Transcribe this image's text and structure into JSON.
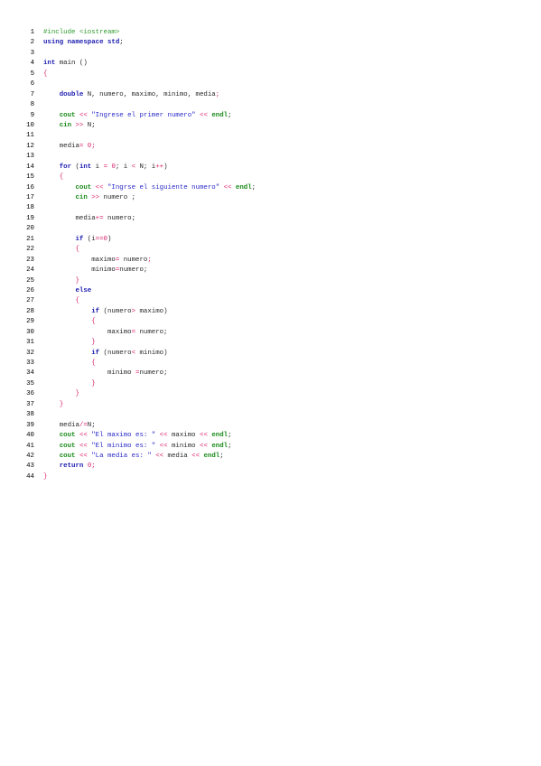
{
  "code": {
    "lines": [
      {
        "n": "1",
        "t": [
          [
            "pp",
            "#include <iostream>"
          ]
        ]
      },
      {
        "n": "2",
        "t": [
          [
            "kw",
            "using namespace std"
          ],
          [
            "pl",
            ";"
          ]
        ]
      },
      {
        "n": "3",
        "t": []
      },
      {
        "n": "4",
        "t": [
          [
            "kw",
            "int"
          ],
          [
            "pl",
            " main ()"
          ]
        ]
      },
      {
        "n": "5",
        "t": [
          [
            "op",
            "{"
          ]
        ]
      },
      {
        "n": "6",
        "t": []
      },
      {
        "n": "7",
        "t": [
          [
            "pl",
            "    "
          ],
          [
            "kw",
            "double"
          ],
          [
            "pl",
            " N, numero, maximo, minimo, media"
          ],
          [
            "op",
            ";"
          ]
        ]
      },
      {
        "n": "8",
        "t": []
      },
      {
        "n": "9",
        "t": [
          [
            "pl",
            "    "
          ],
          [
            "io",
            "cout"
          ],
          [
            "pl",
            " "
          ],
          [
            "op",
            "<<"
          ],
          [
            "pl",
            " "
          ],
          [
            "str",
            "\"Ingrese el primer numero\""
          ],
          [
            "pl",
            " "
          ],
          [
            "op",
            "<<"
          ],
          [
            "pl",
            " "
          ],
          [
            "io",
            "endl"
          ],
          [
            "pl",
            ";"
          ]
        ]
      },
      {
        "n": "10",
        "t": [
          [
            "pl",
            "    "
          ],
          [
            "io",
            "cin"
          ],
          [
            "pl",
            " "
          ],
          [
            "op",
            ">>"
          ],
          [
            "pl",
            " N;"
          ]
        ]
      },
      {
        "n": "11",
        "t": []
      },
      {
        "n": "12",
        "t": [
          [
            "pl",
            "    media"
          ],
          [
            "op",
            "="
          ],
          [
            "pl",
            " "
          ],
          [
            "op",
            "0;"
          ]
        ]
      },
      {
        "n": "13",
        "t": []
      },
      {
        "n": "14",
        "t": [
          [
            "pl",
            "    "
          ],
          [
            "kw",
            "for"
          ],
          [
            "pl",
            " ("
          ],
          [
            "kw",
            "int"
          ],
          [
            "pl",
            " i "
          ],
          [
            "op",
            "="
          ],
          [
            "pl",
            " "
          ],
          [
            "op",
            "0"
          ],
          [
            "pl",
            "; i "
          ],
          [
            "op",
            "<"
          ],
          [
            "pl",
            " N; i"
          ],
          [
            "op",
            "++"
          ],
          [
            "pl",
            ")"
          ]
        ]
      },
      {
        "n": "15",
        "t": [
          [
            "pl",
            "    "
          ],
          [
            "op",
            "{"
          ]
        ]
      },
      {
        "n": "16",
        "t": [
          [
            "pl",
            "        "
          ],
          [
            "io",
            "cout"
          ],
          [
            "pl",
            " "
          ],
          [
            "op",
            "<<"
          ],
          [
            "pl",
            " "
          ],
          [
            "str",
            "\"Ingrse el siguiente numero\""
          ],
          [
            "pl",
            " "
          ],
          [
            "op",
            "<<"
          ],
          [
            "pl",
            " "
          ],
          [
            "io",
            "endl"
          ],
          [
            "pl",
            ";"
          ]
        ]
      },
      {
        "n": "17",
        "t": [
          [
            "pl",
            "        "
          ],
          [
            "io",
            "cin"
          ],
          [
            "pl",
            " "
          ],
          [
            "op",
            ">>"
          ],
          [
            "pl",
            " numero ;"
          ]
        ]
      },
      {
        "n": "18",
        "t": []
      },
      {
        "n": "19",
        "t": [
          [
            "pl",
            "        media"
          ],
          [
            "op",
            "+="
          ],
          [
            "pl",
            " numero;"
          ]
        ]
      },
      {
        "n": "20",
        "t": []
      },
      {
        "n": "21",
        "t": [
          [
            "pl",
            "        "
          ],
          [
            "kw",
            "if"
          ],
          [
            "pl",
            " (i"
          ],
          [
            "op",
            "=="
          ],
          [
            "op",
            "0"
          ],
          [
            "pl",
            ")"
          ]
        ]
      },
      {
        "n": "22",
        "t": [
          [
            "pl",
            "        "
          ],
          [
            "op",
            "{"
          ]
        ]
      },
      {
        "n": "23",
        "t": [
          [
            "pl",
            "            maximo"
          ],
          [
            "op",
            "="
          ],
          [
            "pl",
            " numero"
          ],
          [
            "op",
            ";"
          ]
        ]
      },
      {
        "n": "24",
        "t": [
          [
            "pl",
            "            minimo"
          ],
          [
            "op",
            "="
          ],
          [
            "pl",
            "numero;"
          ]
        ]
      },
      {
        "n": "25",
        "t": [
          [
            "pl",
            "        "
          ],
          [
            "op",
            "}"
          ]
        ]
      },
      {
        "n": "26",
        "t": [
          [
            "pl",
            "        "
          ],
          [
            "kw",
            "else"
          ]
        ]
      },
      {
        "n": "27",
        "t": [
          [
            "pl",
            "        "
          ],
          [
            "op",
            "{"
          ]
        ]
      },
      {
        "n": "28",
        "t": [
          [
            "pl",
            "            "
          ],
          [
            "kw",
            "if"
          ],
          [
            "pl",
            " (numero"
          ],
          [
            "op",
            ">"
          ],
          [
            "pl",
            " maximo)"
          ]
        ]
      },
      {
        "n": "29",
        "t": [
          [
            "pl",
            "            "
          ],
          [
            "op",
            "{"
          ]
        ]
      },
      {
        "n": "30",
        "t": [
          [
            "pl",
            "                maximo"
          ],
          [
            "op",
            "="
          ],
          [
            "pl",
            " numero;"
          ]
        ]
      },
      {
        "n": "31",
        "t": [
          [
            "pl",
            "            "
          ],
          [
            "op",
            "}"
          ]
        ]
      },
      {
        "n": "32",
        "t": [
          [
            "pl",
            "            "
          ],
          [
            "kw",
            "if"
          ],
          [
            "pl",
            " (numero"
          ],
          [
            "op",
            "<"
          ],
          [
            "pl",
            " minimo)"
          ]
        ]
      },
      {
        "n": "33",
        "t": [
          [
            "pl",
            "            "
          ],
          [
            "op",
            "{"
          ]
        ]
      },
      {
        "n": "34",
        "t": [
          [
            "pl",
            "                minimo "
          ],
          [
            "op",
            "="
          ],
          [
            "pl",
            "numero;"
          ]
        ]
      },
      {
        "n": "35",
        "t": [
          [
            "pl",
            "            "
          ],
          [
            "op",
            "}"
          ]
        ]
      },
      {
        "n": "36",
        "t": [
          [
            "pl",
            "        "
          ],
          [
            "op",
            "}"
          ]
        ]
      },
      {
        "n": "37",
        "t": [
          [
            "pl",
            "    "
          ],
          [
            "op",
            "}"
          ]
        ]
      },
      {
        "n": "38",
        "t": []
      },
      {
        "n": "39",
        "t": [
          [
            "pl",
            "    media"
          ],
          [
            "op",
            "/="
          ],
          [
            "pl",
            "N;"
          ]
        ]
      },
      {
        "n": "40",
        "t": [
          [
            "pl",
            "    "
          ],
          [
            "io",
            "cout"
          ],
          [
            "pl",
            " "
          ],
          [
            "op",
            "<<"
          ],
          [
            "pl",
            " "
          ],
          [
            "str",
            "\"El maximo es: \""
          ],
          [
            "pl",
            " "
          ],
          [
            "op",
            "<<"
          ],
          [
            "pl",
            " maximo "
          ],
          [
            "op",
            "<<"
          ],
          [
            "pl",
            " "
          ],
          [
            "io",
            "endl"
          ],
          [
            "pl",
            ";"
          ]
        ]
      },
      {
        "n": "41",
        "t": [
          [
            "pl",
            "    "
          ],
          [
            "io",
            "cout"
          ],
          [
            "pl",
            " "
          ],
          [
            "op",
            "<<"
          ],
          [
            "pl",
            " "
          ],
          [
            "str",
            "\"El minimo es: \""
          ],
          [
            "pl",
            " "
          ],
          [
            "op",
            "<<"
          ],
          [
            "pl",
            " minimo "
          ],
          [
            "op",
            "<<"
          ],
          [
            "pl",
            " "
          ],
          [
            "io",
            "endl"
          ],
          [
            "pl",
            ";"
          ]
        ]
      },
      {
        "n": "42",
        "t": [
          [
            "pl",
            "    "
          ],
          [
            "io",
            "cout"
          ],
          [
            "pl",
            " "
          ],
          [
            "op",
            "<<"
          ],
          [
            "pl",
            " "
          ],
          [
            "str",
            "\"La media es: \""
          ],
          [
            "pl",
            " "
          ],
          [
            "op",
            "<<"
          ],
          [
            "pl",
            " media "
          ],
          [
            "op",
            "<<"
          ],
          [
            "pl",
            " "
          ],
          [
            "io",
            "endl"
          ],
          [
            "pl",
            ";"
          ]
        ]
      },
      {
        "n": "43",
        "t": [
          [
            "pl",
            "    "
          ],
          [
            "kw",
            "return"
          ],
          [
            "pl",
            " "
          ],
          [
            "op",
            "0;"
          ]
        ]
      },
      {
        "n": "44",
        "t": [
          [
            "op",
            "}"
          ]
        ]
      }
    ]
  }
}
